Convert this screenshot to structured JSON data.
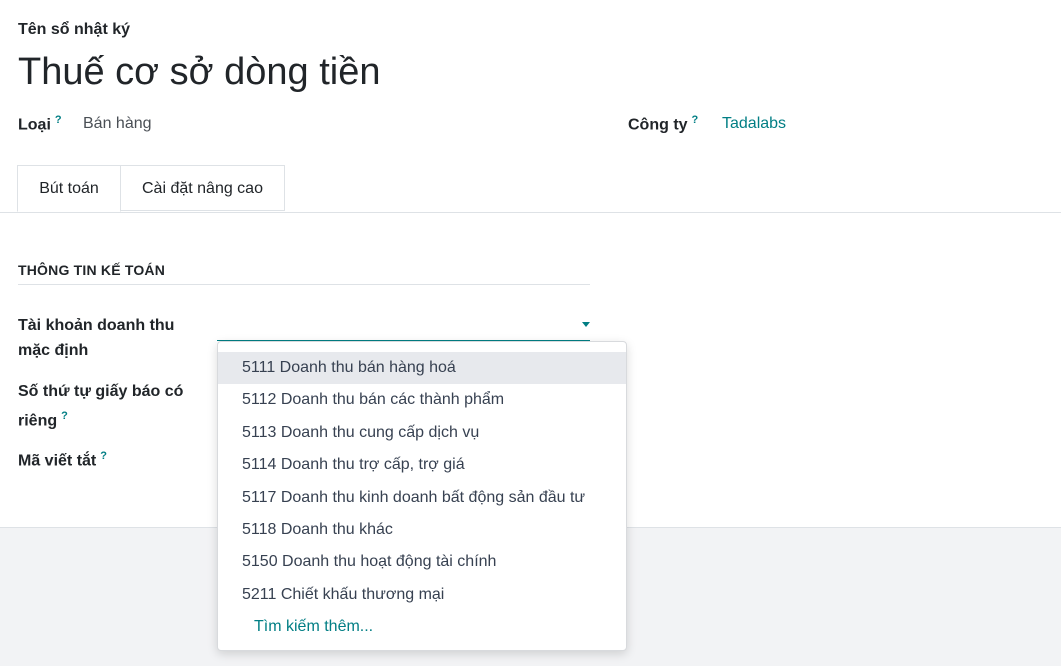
{
  "form": {
    "name_caption": "Tên sổ nhật ký",
    "name_value": "Thuế cơ sở dòng tiền",
    "type_label": "Loại",
    "type_help": "?",
    "type_value": "Bán hàng",
    "company_label": "Công ty",
    "company_help": "?",
    "company_value": "Tadalabs"
  },
  "tabs": [
    {
      "label": "Bút toán",
      "active": true
    },
    {
      "label": "Cài đặt nâng cao",
      "active": false
    }
  ],
  "accounting": {
    "section_title": "THÔNG TIN KẾ TOÁN",
    "default_income_account_label": "Tài khoản doanh thu mặc định",
    "default_income_account_value": "",
    "credit_note_sequence_label": "Số thứ tự giấy báo có riêng",
    "credit_note_sequence_help": "?",
    "short_code_label": "Mã viết tắt",
    "short_code_help": "?"
  },
  "dropdown": {
    "options": [
      "5111 Doanh thu bán hàng hoá",
      "5112 Doanh thu bán các thành phẩm",
      "5113 Doanh thu cung cấp dịch vụ",
      "5114 Doanh thu trợ cấp, trợ giá",
      "5117 Doanh thu kinh doanh bất động sản đầu tư",
      "5118 Doanh thu khác",
      "5150 Doanh thu hoạt động tài chính",
      "5211 Chiết khấu thương mại"
    ],
    "search_more": "Tìm kiếm thêm..."
  },
  "colors": {
    "accent": "#017e84",
    "hover_bg": "#e7e9ed",
    "border": "#dee2e6",
    "footer_bg": "#f2f3f5"
  }
}
